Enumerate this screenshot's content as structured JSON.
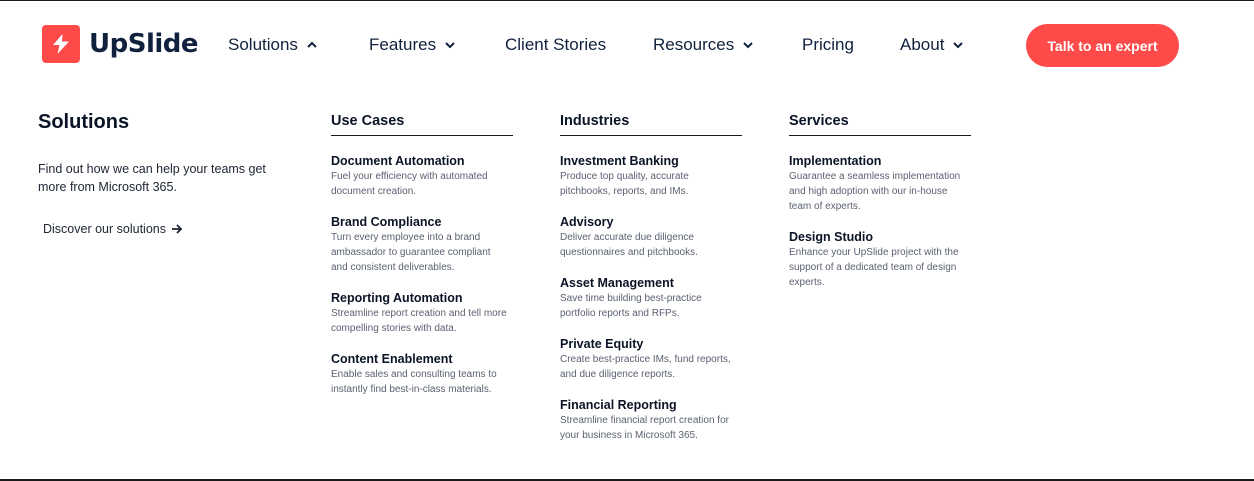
{
  "brand": {
    "name": "UpSlide",
    "color": "#ff4a4a",
    "icon": "upslide-logo-icon"
  },
  "nav": {
    "items": [
      {
        "label": "Solutions",
        "chevron": "chevron-up-icon"
      },
      {
        "label": "Features",
        "chevron": "chevron-down-icon"
      },
      {
        "label": "Client Stories",
        "chevron": ""
      },
      {
        "label": "Resources",
        "chevron": "chevron-down-icon"
      },
      {
        "label": "Pricing",
        "chevron": ""
      },
      {
        "label": "About",
        "chevron": "chevron-down-icon"
      }
    ],
    "cta": "Talk to an expert"
  },
  "menu": {
    "intro": {
      "title": "Solutions",
      "description": "Find out how we can help your teams get more from Microsoft 365.",
      "link": "Discover our solutions",
      "link_icon": "arrow-right-icon"
    },
    "columns": [
      {
        "heading": "Use Cases",
        "items": [
          {
            "title": "Document Automation",
            "desc": "Fuel your efficiency with automated document creation."
          },
          {
            "title": "Brand Compliance",
            "desc": "Turn every employee into a brand ambassador to guarantee compliant and consistent deliverables."
          },
          {
            "title": "Reporting Automation",
            "desc": "Streamline report creation and tell more compelling stories with data."
          },
          {
            "title": "Content Enablement",
            "desc": "Enable sales and consulting teams to instantly find best-in-class materials."
          }
        ]
      },
      {
        "heading": "Industries",
        "items": [
          {
            "title": "Investment Banking",
            "desc": "Produce top quality, accurate pitchbooks, reports, and IMs."
          },
          {
            "title": "Advisory",
            "desc": "Deliver accurate due diligence questionnaires and pitchbooks."
          },
          {
            "title": "Asset Management",
            "desc": "Save time building best-practice portfolio reports and RFPs."
          },
          {
            "title": "Private Equity",
            "desc": "Create best-practice IMs, fund reports, and due diligence reports."
          },
          {
            "title": "Financial Reporting",
            "desc": "Streamline financial report creation for your business in Microsoft 365."
          }
        ]
      },
      {
        "heading": "Services",
        "items": [
          {
            "title": "Implementation",
            "desc": "Guarantee a seamless implementation and high adoption with our in-house team of experts."
          },
          {
            "title": "Design Studio",
            "desc": "Enhance your UpSlide project with the support of a dedicated team of design experts."
          }
        ]
      }
    ]
  }
}
